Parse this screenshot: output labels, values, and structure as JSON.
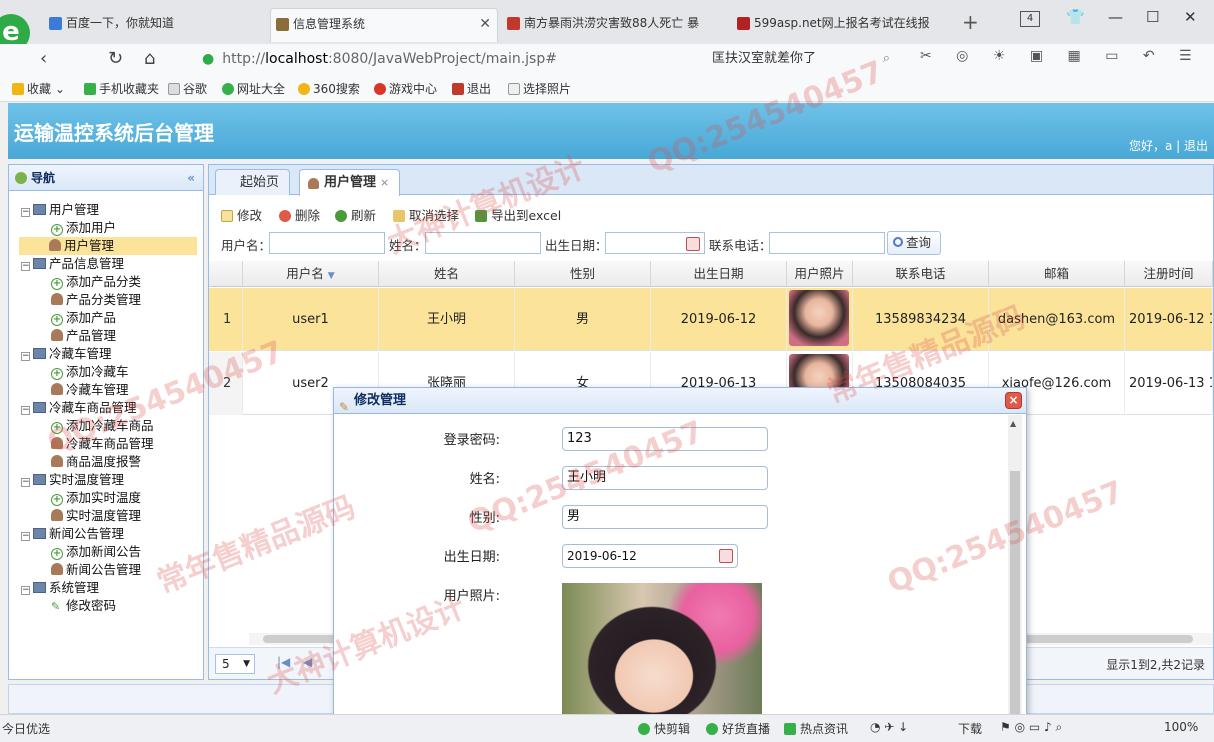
{
  "browser": {
    "tabs": [
      {
        "title": "百度一下，你就知道",
        "color": "#3a7bd5"
      },
      {
        "title": "信息管理系统",
        "color": "#8a6d3b"
      },
      {
        "title": "南方暴雨洪涝灾害致88人死亡 暴",
        "color": "#c0392b"
      },
      {
        "title": "599asp.net网上报名考试在线报",
        "color": "#b22222"
      }
    ],
    "tab_count": "4",
    "url": {
      "prefix": "http://",
      "host": "localhost",
      "rest": ":8080/JavaWebProject/main.jsp#"
    },
    "search_text": "匡扶汉室就差你了",
    "bookmarks": [
      "收藏",
      "手机收藏夹",
      "谷歌",
      "网址大全",
      "360搜索",
      "游戏中心",
      "退出",
      "选择照片"
    ]
  },
  "app": {
    "title": "运输温控系统后台管理",
    "greeting": "您好，a",
    "logout": "退出"
  },
  "sidebar": {
    "title": "导航",
    "groups": [
      {
        "label": "用户管理",
        "items": [
          "添加用户",
          "用户管理"
        ]
      },
      {
        "label": "产品信息管理",
        "items": [
          "添加产品分类",
          "产品分类管理",
          "添加产品",
          "产品管理"
        ]
      },
      {
        "label": "冷藏车管理",
        "items": [
          "添加冷藏车",
          "冷藏车管理"
        ]
      },
      {
        "label": "冷藏车商品管理",
        "items": [
          "添加冷藏车商品",
          "冷藏车商品管理",
          "商品温度报警"
        ]
      },
      {
        "label": "实时温度管理",
        "items": [
          "添加实时温度",
          "实时温度管理"
        ]
      },
      {
        "label": "新闻公告管理",
        "items": [
          "添加新闻公告",
          "新闻公告管理"
        ]
      },
      {
        "label": "系统管理",
        "items": [
          "修改密码"
        ]
      }
    ]
  },
  "main": {
    "tabs": [
      "起始页",
      "用户管理"
    ],
    "toolbar": [
      "修改",
      "删除",
      "刷新",
      "取消选择",
      "导出到excel"
    ],
    "filters": {
      "username": "用户名：",
      "name": "姓名：",
      "birth": "出生日期：",
      "phone": "联系电话：",
      "search": "查询"
    },
    "columns": [
      "用户名",
      "姓名",
      "性别",
      "出生日期",
      "用户照片",
      "联系电话",
      "邮箱",
      "注册时间"
    ],
    "rows": [
      {
        "num": "1",
        "username": "user1",
        "name": "王小明",
        "gender": "男",
        "birth": "2019-06-12",
        "phone": "13589834234",
        "email": "dashen@163.com",
        "reg": "2019-06-12 1"
      },
      {
        "num": "2",
        "username": "user2",
        "name": "张晓丽",
        "gender": "女",
        "birth": "2019-06-13",
        "phone": "13508084035",
        "email": "xiaofe@126.com",
        "reg": "2019-06-13 1"
      }
    ],
    "page_size": "5",
    "page_info": "显示1到2,共2记录"
  },
  "dialog": {
    "title": "修改管理",
    "fields": [
      {
        "label": "登录密码:",
        "value": "123"
      },
      {
        "label": "姓名:",
        "value": "王小明"
      },
      {
        "label": "性别:",
        "value": "男"
      },
      {
        "label": "出生日期:",
        "value": "2019-06-12"
      },
      {
        "label": "用户照片:"
      }
    ]
  },
  "statusbar": {
    "left": "今日优选",
    "items": [
      "快剪辑",
      "好货直播",
      "热点资讯",
      "下载"
    ],
    "zoom": "100%"
  },
  "watermark": [
    "QQ:254540457",
    "大神计算机设计",
    "常年售精品源码"
  ]
}
